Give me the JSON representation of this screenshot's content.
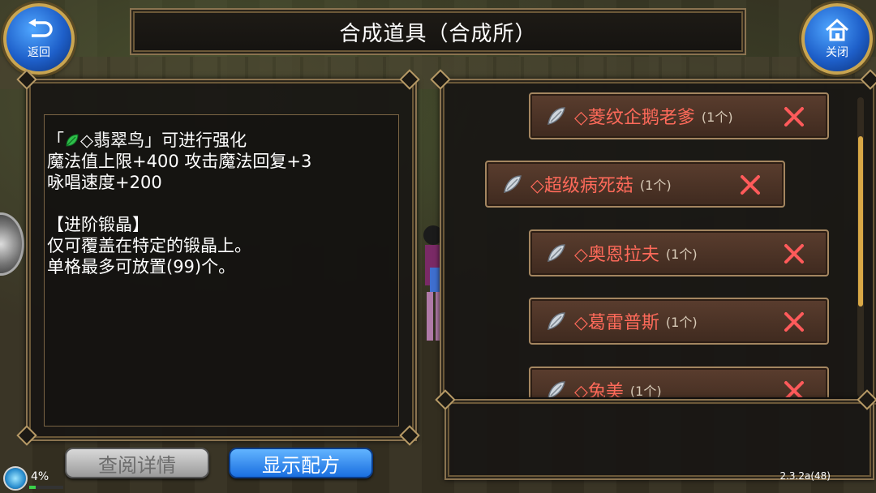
{
  "header": {
    "title": "合成道具（合成所）",
    "back_label": "返回",
    "close_label": "关闭"
  },
  "info": {
    "lines": [
      "「",
      "◇翡翠鸟」可进行强化",
      "魔法值上限+400 攻击魔法回复+3",
      "咏唱速度+200",
      "【进阶锻晶】",
      "仅可覆盖在特定的锻晶上。",
      "单格最多可放置(99)个。"
    ]
  },
  "buttons": {
    "details_label": "查阅详情",
    "recipe_label": "显示配方"
  },
  "items": [
    {
      "name": "◇菱纹企鹅老爹",
      "count": "(1个)"
    },
    {
      "name": "◇超级病死菇",
      "count": "(1个)"
    },
    {
      "name": "◇奥恩拉夫",
      "count": "(1个)"
    },
    {
      "name": "◇葛雷普斯",
      "count": "(1个)"
    },
    {
      "name": "◇兔美",
      "count": "(1个)"
    }
  ],
  "status": {
    "percent": "4%",
    "progress": 0.04,
    "version": "2.3.2a(48)"
  },
  "colors": {
    "item_name": "#ff6a5a",
    "accent_blue": "#1a6fe0",
    "frame_gold": "#8a7350",
    "remove_x": "#ff5a5a"
  },
  "icons": {
    "back": "return-arrow-icon",
    "close": "home-icon",
    "item": "crystal-gem-icon",
    "remove": "close-x-icon",
    "leaf": "green-leaf-icon"
  }
}
